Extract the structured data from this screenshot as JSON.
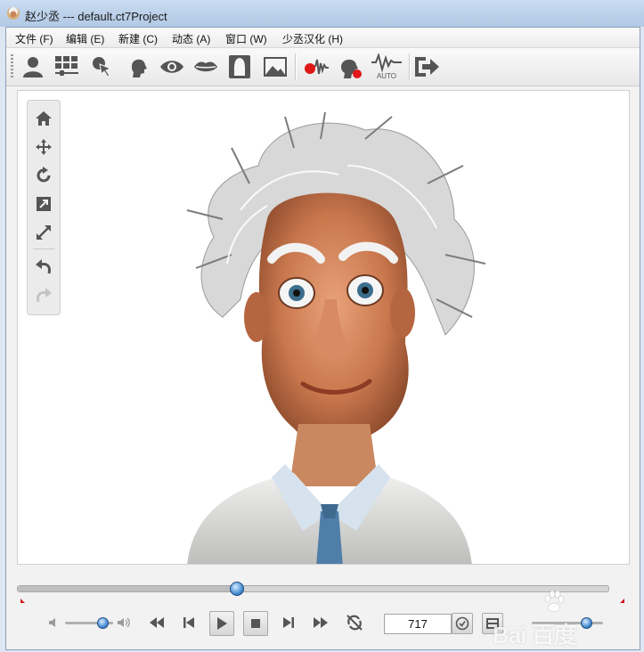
{
  "window": {
    "title": "赵少丞 --- default.ct7Project"
  },
  "menu": {
    "items": [
      "文件 (F)",
      "编辑 (E)",
      "新建 (C)",
      "动态 (A)",
      "窗口 (W)",
      "少丞汉化 (H)"
    ]
  },
  "toolbar": {
    "buttons": [
      {
        "icon": "actor-icon"
      },
      {
        "icon": "content-manager-icon"
      },
      {
        "icon": "composer-icon"
      },
      {
        "icon": "head-icon"
      },
      {
        "icon": "eye-icon"
      },
      {
        "icon": "lips-icon"
      },
      {
        "icon": "face-mask-icon"
      },
      {
        "icon": "image-icon"
      },
      {
        "icon": "record-audio-icon"
      },
      {
        "icon": "record-face-icon"
      },
      {
        "icon": "auto-motion-icon",
        "label": "AUTO"
      },
      {
        "icon": "export-icon"
      }
    ]
  },
  "side_tools": {
    "buttons": [
      "home-icon",
      "move-icon",
      "rotate-icon",
      "fit-icon",
      "zoom-icon",
      "undo-icon",
      "redo-icon"
    ]
  },
  "timeline": {
    "position_fraction": 0.37
  },
  "playback": {
    "volume_fraction": 0.75,
    "frame": "717",
    "speed_fraction": 0.75
  },
  "watermark": {
    "text": "Bai 百度"
  },
  "colors": {
    "titlebar": "#c0d4ec",
    "accent_blue": "#3e86cf",
    "record_red": "#e01818"
  }
}
